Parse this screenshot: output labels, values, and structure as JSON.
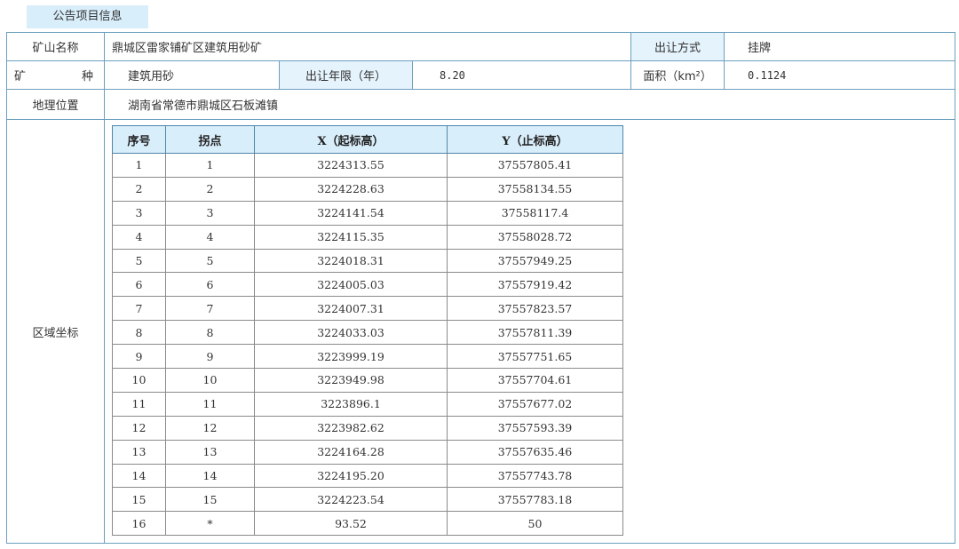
{
  "section_title": "公告项目信息",
  "mine_name": {
    "label": "矿山名称",
    "value": "鼎城区雷家铺矿区建筑用砂矿"
  },
  "transfer_method": {
    "label": "出让方式",
    "value": "挂牌"
  },
  "mineral_type": {
    "label_left": "矿",
    "label_right": "种",
    "value": "建筑用砂"
  },
  "transfer_period": {
    "label": "出让年限（年）",
    "value": "8.20"
  },
  "area": {
    "label": "面积（km²）",
    "value": "0.1124"
  },
  "location": {
    "label": "地理位置",
    "value": "湖南省常德市鼎城区石板滩镇"
  },
  "region_coords": {
    "label": "区域坐标",
    "headers": [
      "序号",
      "拐点",
      "X（起标高）",
      "Y（止标高）"
    ],
    "rows": [
      [
        "1",
        "1",
        "3224313.55",
        "37557805.41"
      ],
      [
        "2",
        "2",
        "3224228.63",
        "37558134.55"
      ],
      [
        "3",
        "3",
        "3224141.54",
        "37558117.4"
      ],
      [
        "4",
        "4",
        "3224115.35",
        "37558028.72"
      ],
      [
        "5",
        "5",
        "3224018.31",
        "37557949.25"
      ],
      [
        "6",
        "6",
        "3224005.03",
        "37557919.42"
      ],
      [
        "7",
        "7",
        "3224007.31",
        "37557823.57"
      ],
      [
        "8",
        "8",
        "3224033.03",
        "37557811.39"
      ],
      [
        "9",
        "9",
        "3223999.19",
        "37557751.65"
      ],
      [
        "10",
        "10",
        "3223949.98",
        "37557704.61"
      ],
      [
        "11",
        "11",
        "3223896.1",
        "37557677.02"
      ],
      [
        "12",
        "12",
        "3223982.62",
        "37557593.39"
      ],
      [
        "13",
        "13",
        "3224164.28",
        "37557635.46"
      ],
      [
        "14",
        "14",
        "3224195.20",
        "37557743.78"
      ],
      [
        "15",
        "15",
        "3224223.54",
        "37557783.18"
      ],
      [
        "16",
        "*",
        "93.52",
        "50"
      ]
    ]
  }
}
